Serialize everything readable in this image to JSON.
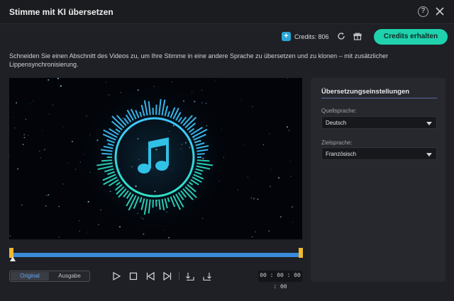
{
  "window": {
    "title": "Stimme mit KI übersetzen",
    "help_glyph": "?"
  },
  "credits": {
    "badge_glyph": "+",
    "label": "Credits: 806",
    "button_label": "Credits erhalten"
  },
  "description": "Schneiden Sie einen Abschnitt des Videos zu, um Ihre Stimme in eine andere Sprache zu übersetzen und zu klonen – mit zusätzlicher Lippensynchronisierung.",
  "player": {
    "tabs": [
      {
        "label": "Original",
        "active": true
      },
      {
        "label": "Ausgabe",
        "active": false
      }
    ],
    "timecode": "00 : 00 : 00 : 00",
    "controls": [
      "play-icon",
      "stop-icon",
      "previous-frame-icon",
      "next-frame-icon",
      "mark-in-icon",
      "mark-out-icon"
    ]
  },
  "settings": {
    "title": "Übersetzungseinstellungen",
    "source_label": "Quellsprache:",
    "source_value": "Deutsch",
    "target_label": "Zielsprache:",
    "target_value": "Französisch"
  },
  "colors": {
    "accent": "#1fd2ad",
    "timeline": "#3a8bd9",
    "handle": "#f2b92c",
    "active_tab": "#5fa8ff"
  }
}
